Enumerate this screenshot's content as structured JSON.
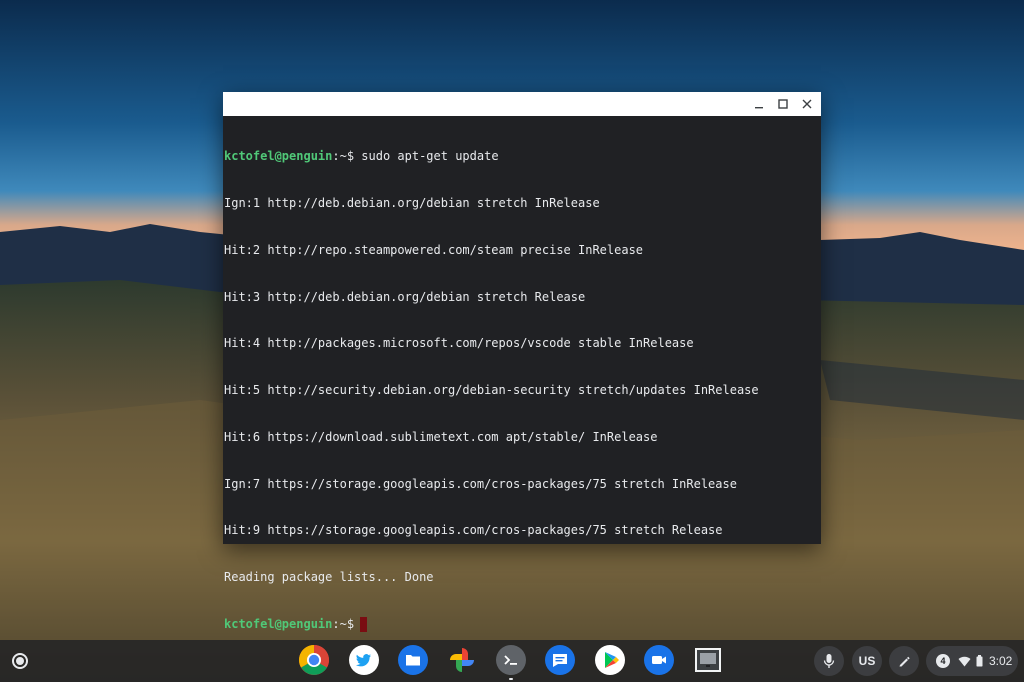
{
  "terminal": {
    "lines": [
      {
        "user": "kctofel@penguin",
        "path": ":~",
        "prompt": "$",
        "command": " sudo apt-get update"
      },
      {
        "text": "Ign:1 http://deb.debian.org/debian stretch InRelease"
      },
      {
        "text": "Hit:2 http://repo.steampowered.com/steam precise InRelease"
      },
      {
        "text": "Hit:3 http://deb.debian.org/debian stretch Release"
      },
      {
        "text": "Hit:4 http://packages.microsoft.com/repos/vscode stable InRelease"
      },
      {
        "text": "Hit:5 http://security.debian.org/debian-security stretch/updates InRelease"
      },
      {
        "text": "Hit:6 https://download.sublimetext.com apt/stable/ InRelease"
      },
      {
        "text": "Ign:7 https://storage.googleapis.com/cros-packages/75 stretch InRelease"
      },
      {
        "text": "Hit:9 https://storage.googleapis.com/cros-packages/75 stretch Release"
      },
      {
        "text": "Reading package lists... Done"
      },
      {
        "user": "kctofel@penguin",
        "path": ":~",
        "prompt": "$",
        "command": ""
      }
    ]
  },
  "window_controls": [
    "minimize-icon",
    "maximize-icon",
    "close-icon"
  ],
  "shelf": {
    "apps": [
      {
        "name": "chrome-icon"
      },
      {
        "name": "twitter-icon"
      },
      {
        "name": "files-icon"
      },
      {
        "name": "photos-icon"
      },
      {
        "name": "terminal-icon"
      },
      {
        "name": "messages-icon"
      },
      {
        "name": "play-store-icon"
      },
      {
        "name": "duo-icon"
      },
      {
        "name": "screenshot-app-icon"
      }
    ],
    "tray": {
      "input_method": "US",
      "notification_count": "4",
      "time": "3:02"
    }
  },
  "colors": {
    "terminal_bg": "#202124",
    "prompt_user": "#50c878",
    "cursor": "#7a0d12",
    "shelf_bg": "#202124"
  }
}
